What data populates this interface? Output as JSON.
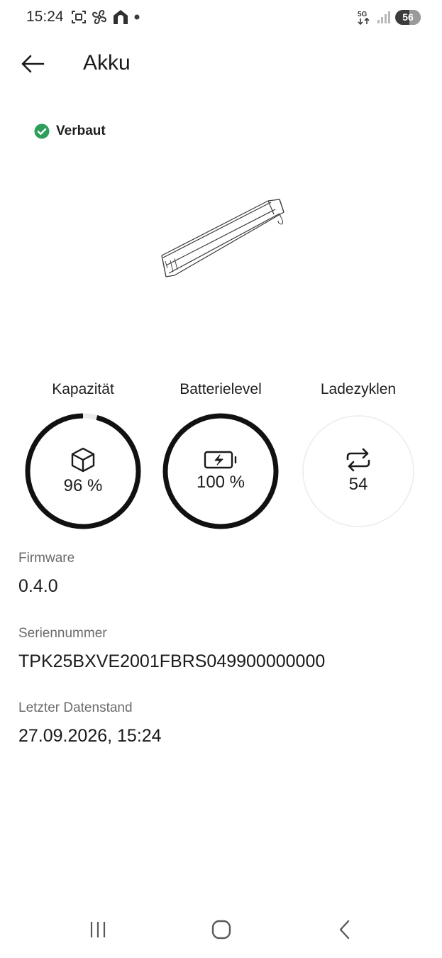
{
  "status_bar": {
    "time": "15:24",
    "network": "5G",
    "battery": "56",
    "battery_level": 0.56,
    "icons": [
      "screenshot-icon",
      "fan-icon",
      "home-app-icon",
      "notification-dot-icon",
      "network-5g-icon",
      "signal-icon",
      "battery-icon"
    ]
  },
  "header": {
    "title": "Akku",
    "back_icon": "arrow-left-icon"
  },
  "installed": {
    "label": "Verbaut",
    "icon": "check-circle-icon",
    "color": "#2e9e5b"
  },
  "stats": [
    {
      "label": "Kapazität",
      "value": "96 %",
      "level": 0.96,
      "icon": "cube-icon"
    },
    {
      "label": "Batterielevel",
      "value": "100 %",
      "level": 1.0,
      "icon": "battery-charging-icon"
    },
    {
      "label": "Ladezyklen",
      "value": "54",
      "level": 0,
      "icon": "cycle-arrows-icon"
    }
  ],
  "info": [
    {
      "label": "Firmware",
      "value": "0.4.0"
    },
    {
      "label": "Seriennummer",
      "value": "TPK25BXVE2001FBRS049900000000"
    },
    {
      "label": "Letzter Datenstand",
      "value": "27.09.2026, 15:24"
    }
  ],
  "colors": {
    "ring_active": "#111111",
    "ring_track": "#ebebeb"
  },
  "nav_icons": [
    "recent-apps-icon",
    "home-icon",
    "back-icon"
  ]
}
